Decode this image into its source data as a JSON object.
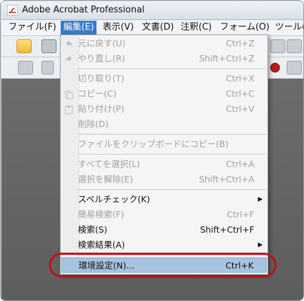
{
  "window": {
    "title": "Adobe Acrobat Professional"
  },
  "menubar": {
    "items": [
      {
        "label": "ファイル(F)"
      },
      {
        "label": "編集(E)"
      },
      {
        "label": "表示(V)"
      },
      {
        "label": "文書(D)"
      },
      {
        "label": "注釈(C)"
      },
      {
        "label": "フォーム(O)"
      },
      {
        "label": "ツール(T"
      }
    ]
  },
  "edit_menu": {
    "items": [
      {
        "label": "元に戻す(U)",
        "shortcut": "Ctrl+Z",
        "enabled": false,
        "icon": "undo-icon"
      },
      {
        "label": "やり直し(R)",
        "shortcut": "Shift+Ctrl+Z",
        "enabled": false,
        "icon": "redo-icon"
      },
      {
        "label": "切り取り(T)",
        "shortcut": "Ctrl+X",
        "enabled": false
      },
      {
        "label": "コピー(C)",
        "shortcut": "Ctrl+C",
        "enabled": false,
        "icon": "copy-icon"
      },
      {
        "label": "貼り付け(P)",
        "shortcut": "Ctrl+V",
        "enabled": false,
        "icon": "paste-icon"
      },
      {
        "label": "削除(D)",
        "shortcut": "",
        "enabled": false
      },
      {
        "label": "ファイルをクリップボードにコピー(B)",
        "shortcut": "",
        "enabled": false
      },
      {
        "label": "すべてを選択(L)",
        "shortcut": "Ctrl+A",
        "enabled": false
      },
      {
        "label": "選択を解除(E)",
        "shortcut": "Shift+Ctrl+A",
        "enabled": false
      },
      {
        "label": "スペルチェック(K)",
        "shortcut": "",
        "enabled": true,
        "submenu": true
      },
      {
        "label": "簡易検索(F)",
        "shortcut": "Ctrl+F",
        "enabled": false
      },
      {
        "label": "検索(S)",
        "shortcut": "Shift+Ctrl+F",
        "enabled": true
      },
      {
        "label": "検索結果(A)",
        "shortcut": "",
        "enabled": true,
        "submenu": true
      },
      {
        "label": "環境設定(N)...",
        "shortcut": "Ctrl+K",
        "enabled": true,
        "highlighted": true
      }
    ]
  },
  "colors": {
    "highlight_ring": "#c10f16",
    "menu_active": "#3a79c5",
    "item_highlight": "#a8c3df"
  }
}
